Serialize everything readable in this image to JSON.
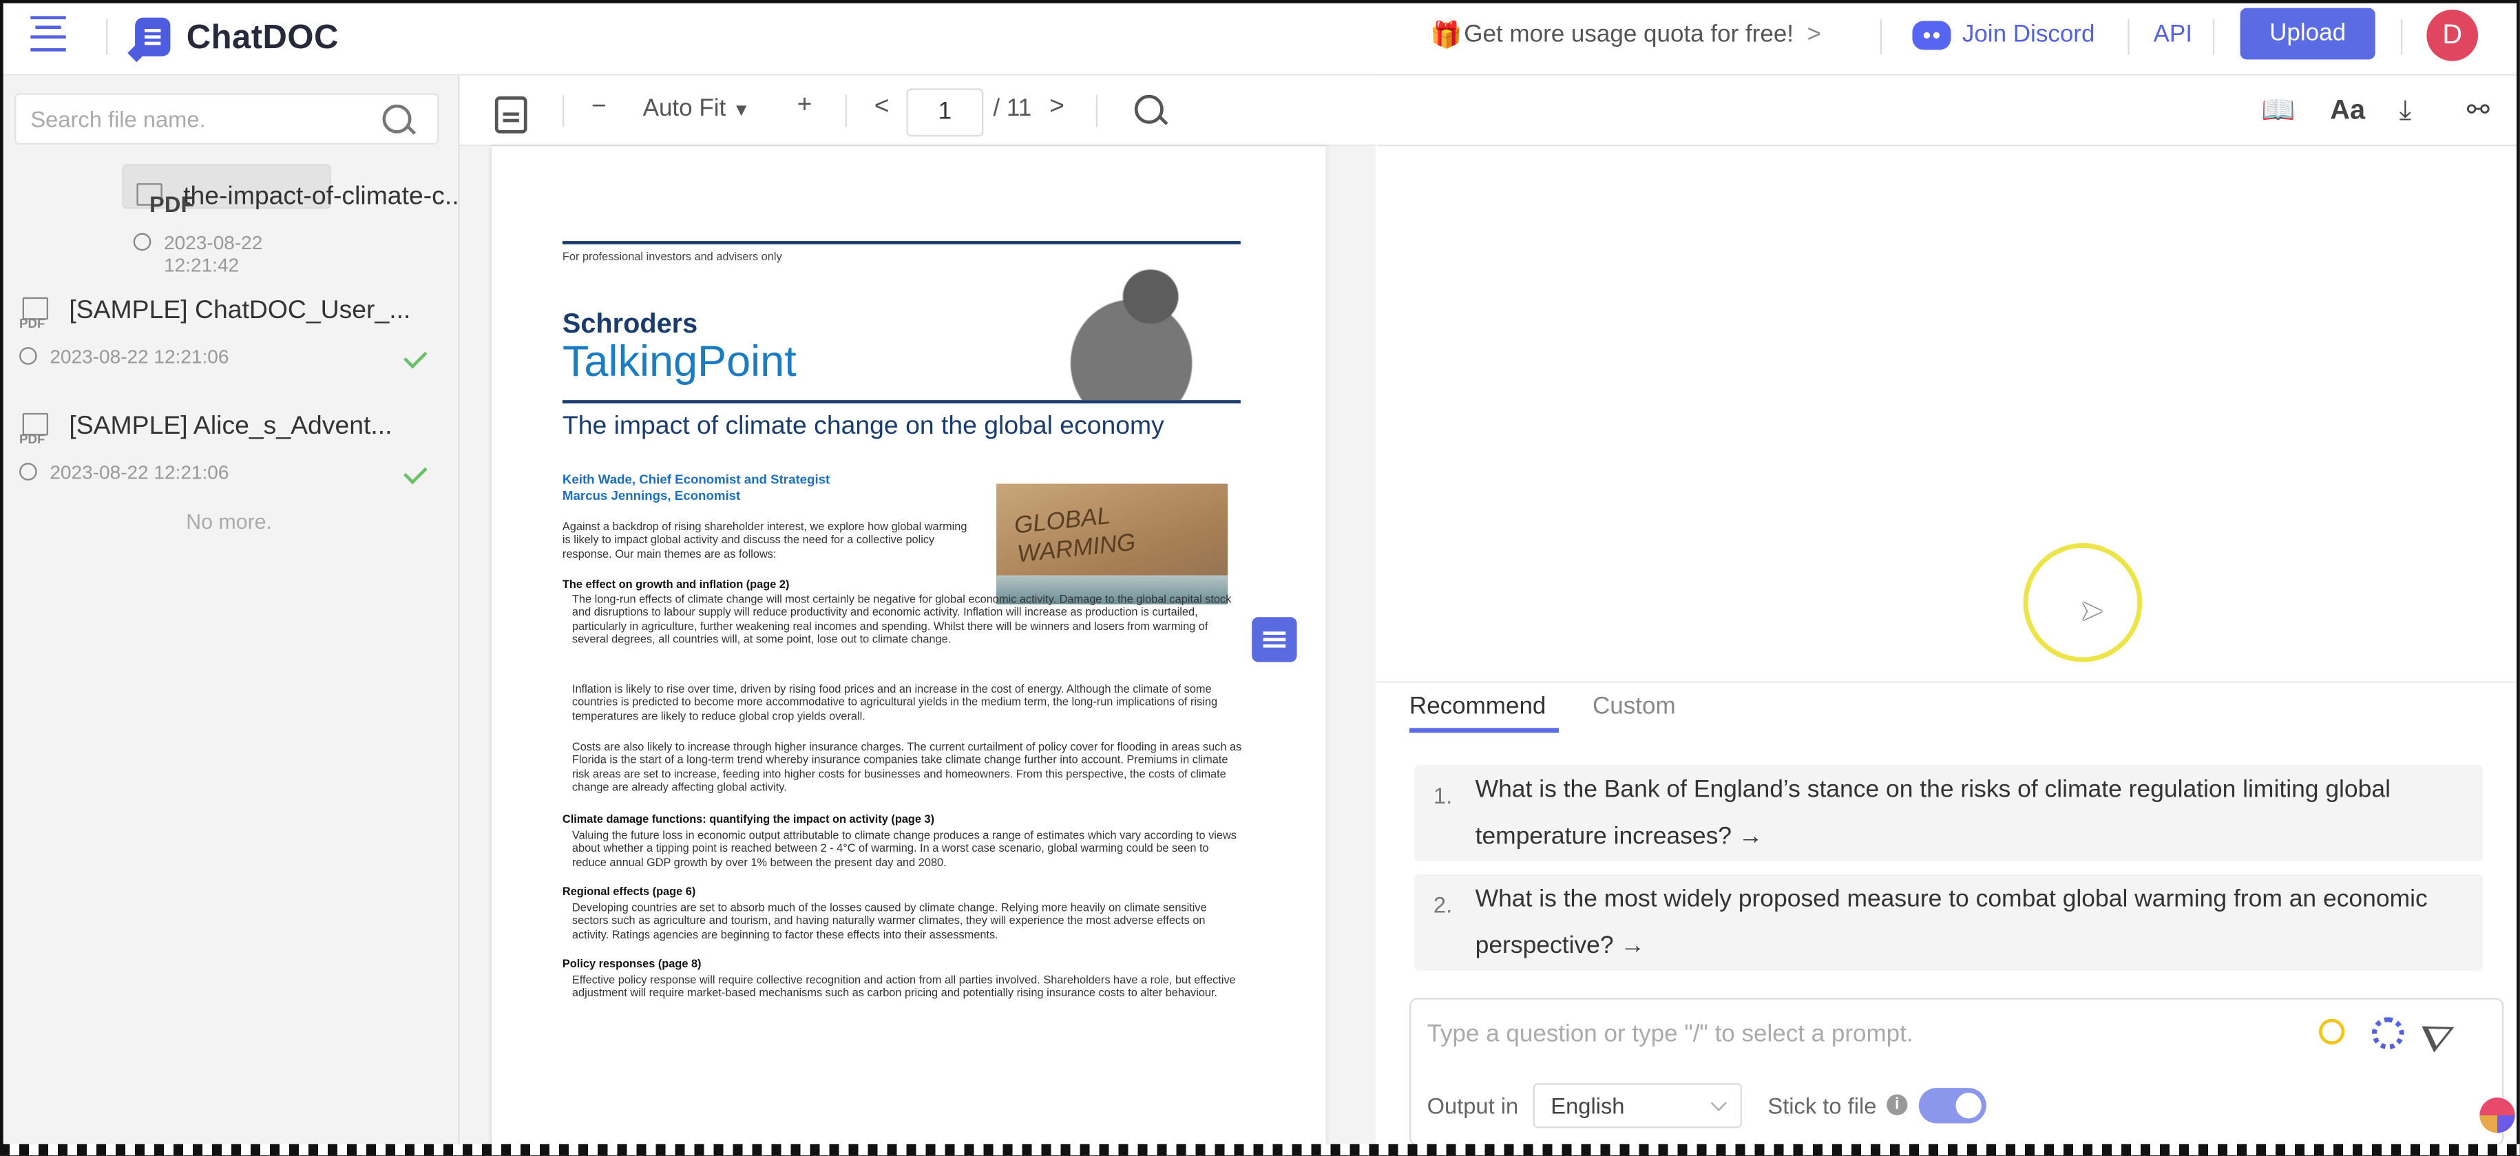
{
  "app": {
    "name": "ChatDOC"
  },
  "header": {
    "quota_text": "Get more usage quota for free!",
    "quota_chevron": ">",
    "discord_label": "Join Discord",
    "api_label": "API",
    "upload_label": "Upload",
    "avatar_initial": "D"
  },
  "sidebar": {
    "search_placeholder": "Search file name.",
    "files": [
      {
        "icon": "pdf-file-icon",
        "name": "the-impact-of-climate-c...",
        "time": "2023-08-22 12:21:42",
        "status": "checked",
        "selected": true
      },
      {
        "icon": "pdf-file-icon",
        "name": "[SAMPLE] ChatDOC_User_...",
        "time": "2023-08-22 12:21:06",
        "status": "checked",
        "selected": false
      },
      {
        "icon": "pdf-file-icon",
        "name": "[SAMPLE] Alice_s_Advent...",
        "time": "2023-08-22 12:21:06",
        "status": "checked",
        "selected": false
      }
    ],
    "no_more": "No more."
  },
  "pdf_toolbar": {
    "minus": "−",
    "zoom_mode": "Auto Fit",
    "plus": "+",
    "prev": "<",
    "page": "1",
    "total": "/ 11",
    "next": ">"
  },
  "document": {
    "audience": "For professional investors and advisers only",
    "brand": "Schroders",
    "series": "TalkingPoint",
    "title": "The impact of climate change on the global economy",
    "author1": "Keith Wade, Chief Economist and Strategist",
    "author2": "Marcus Jennings, Economist",
    "photo_text_1": "GLOBAL",
    "photo_text_2": "WARMING",
    "intro": "Against a backdrop of rising shareholder interest, we explore how global warming is likely to impact global activity and discuss the need for a collective policy response. Our main themes are as follows:",
    "h1": "The effect on growth and inflation (page 2)",
    "p1": "The long-run effects of climate change will most certainly be negative for global economic activity. Damage to the global capital stock and disruptions to labour supply will reduce productivity and economic activity. Inflation will increase as production is curtailed, particularly in agriculture, further weakening real incomes and spending. Whilst there will be winners and losers from warming of several degrees, all countries will, at some point, lose out to climate change.",
    "p2": "Inflation is likely to rise over time, driven by rising food prices and an increase in the cost of energy. Although the climate of some countries is predicted to become more accommodative to agricultural yields in the medium term, the long-run implications of rising temperatures are likely to reduce global crop yields overall.",
    "p3": "Costs are also likely to increase through higher insurance charges. The current curtailment of policy cover for flooding in areas such as Florida is the start of a long-term trend whereby insurance companies take climate change further into account. Premiums in climate risk areas are set to increase, feeding into higher costs for businesses and homeowners. From this perspective, the costs of climate change are already affecting global activity.",
    "h2": "Climate damage functions: quantifying the impact on activity (page 3)",
    "p4": "Valuing the future loss in economic output attributable to climate change produces a range of estimates which vary according to views about whether a tipping point is reached between 2 - 4°C of warming. In a worst case scenario, global warming could be seen to reduce annual GDP growth by over 1% between the present day and 2080.",
    "h3": "Regional effects (page 6)",
    "p5": "Developing countries are set to absorb much of the losses caused by climate change. Relying more heavily on climate sensitive sectors such as agriculture and tourism, and having naturally warmer climates, they will experience the most adverse effects on activity. Ratings agencies are beginning to factor these effects into their assessments.",
    "h4": "Policy responses (page 8)",
    "p6": "Effective policy response will require collective recognition and action from all parties involved. Shareholders have a role, but effective adjustment will require market-based mechanisms such as carbon pricing and potentially rising insurance costs to alter behaviour."
  },
  "chat": {
    "tabs": [
      "Recommend",
      "Custom"
    ],
    "active_tab": "Recommend",
    "questions": [
      {
        "num": "1.",
        "text": "What is the Bank of England’s stance on the risks of climate regulation limiting global temperature increases? →"
      },
      {
        "num": "2.",
        "text": "What is the most widely proposed measure to combat global warming from an economic perspective? →"
      }
    ],
    "input_placeholder": "Type a question or type \"/\" to select a prompt.",
    "output_label": "Output in",
    "output_language": "English",
    "stick_label": "Stick to file",
    "stick_enabled": true
  },
  "colors": {
    "accent": "#5b6be3",
    "brand_dark": "#262a3b",
    "success": "#6cc06c"
  }
}
